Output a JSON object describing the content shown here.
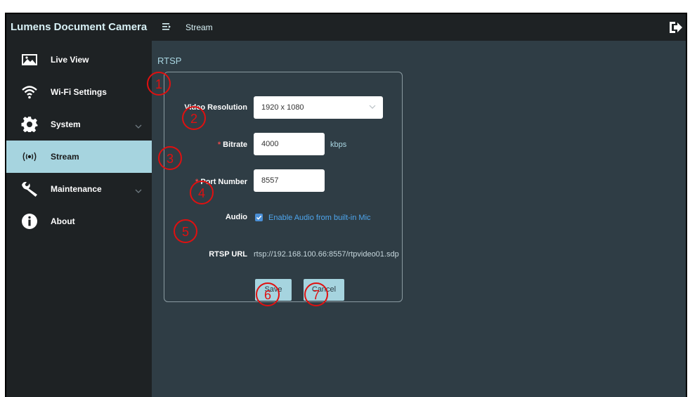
{
  "app": {
    "title": "Lumens Document Camera"
  },
  "header": {
    "breadcrumb": "Stream"
  },
  "sidebar": {
    "items": [
      {
        "label": "Live View"
      },
      {
        "label": "Wi-Fi Settings"
      },
      {
        "label": "System"
      },
      {
        "label": "Stream"
      },
      {
        "label": "Maintenance"
      },
      {
        "label": "About"
      }
    ]
  },
  "rtsp": {
    "section_title": "RTSP",
    "video_resolution": {
      "label": "Video Resolution",
      "value": "1920 x 1080"
    },
    "bitrate": {
      "label": "Bitrate",
      "value": "4000",
      "unit": "kbps"
    },
    "port_number": {
      "label": "Port Number",
      "value": "8557"
    },
    "audio": {
      "label": "Audio",
      "checkbox_label": "Enable Audio from built-in Mic",
      "checked": true
    },
    "rtsp_url": {
      "label": "RTSP URL",
      "value": "rtsp://192.168.100.66:8557/rtpvideo01.sdp"
    },
    "save_label": "Save",
    "cancel_label": "Cancel"
  },
  "annotations": [
    "1",
    "2",
    "3",
    "4",
    "5",
    "6",
    "7"
  ],
  "colors": {
    "topbar_bg": "#1e2224",
    "content_bg": "#2f3d45",
    "accent": "#a6d4df",
    "required": "#e04a4a",
    "link": "#4ea6ee",
    "annotation": "#e01010"
  }
}
